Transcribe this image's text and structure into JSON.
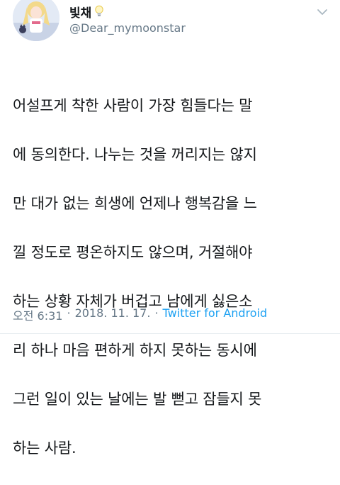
{
  "user": {
    "display_name": "빛채",
    "handle": "@Dear_mymoonstar",
    "avatar_icon": "anime-character-avatar",
    "badge_icon": "lightbulb-icon"
  },
  "tweet": {
    "lines": [
      "어설프게 착한 사람이 가장 힘들다는 말",
      "에 동의한다. 나누는 것을 꺼리지는 않지",
      "만 대가 없는 희생에 언제나 행복감을 느",
      "낄 정도로 평온하지도 않으며, 거절해야",
      "하는 상황 자체가 버겁고 남에게 싫은소",
      "리 하나 마음 편하게 하지 못하는 동시에",
      "그런 일이 있는 날에는 발 뻗고 잠들지 못",
      "하는 사람."
    ]
  },
  "meta": {
    "time": "오전 6:31",
    "date": "2018. 11. 17.",
    "separator": "·",
    "source": "Twitter for Android"
  },
  "colors": {
    "text": "#14171a",
    "secondary": "#657786",
    "link": "#1da1f2"
  }
}
